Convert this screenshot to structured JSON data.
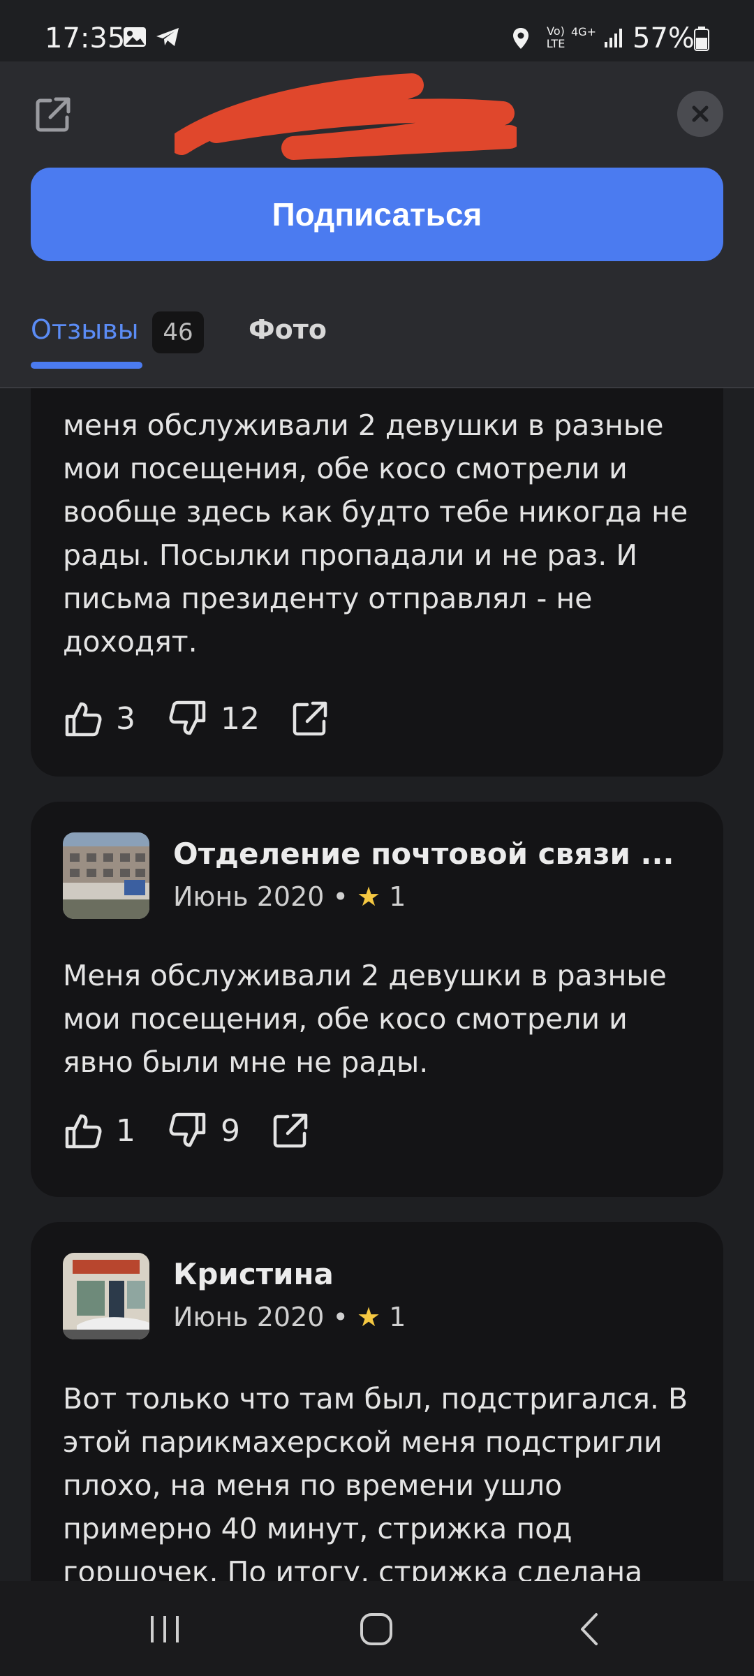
{
  "status_bar": {
    "time": "17:35",
    "battery": "57%",
    "net_lte": "Vo) LTE",
    "net_4g": "4G+"
  },
  "header": {
    "subscribe_label": "Подписаться",
    "tabs": [
      {
        "label": "Отзывы",
        "count": "46"
      },
      {
        "label": "Фото"
      }
    ],
    "accent_color": "#4b7bf0"
  },
  "reviews": [
    {
      "text": "меня обслуживали 2 девушки в разные мои посещения, обе косо смотрели и вообще здесь как будто тебе никогда не рады. Посылки пропадали и не раз. И письма президенту отправлял - не доходят.",
      "likes": "3",
      "dislikes": "12"
    },
    {
      "author": "Отделение почтовой связи ...",
      "date": "Июнь 2020",
      "rating": "1",
      "text": "Меня обслуживали 2 девушки в разные мои посещения, обе косо смотрели и явно были мне не рады.",
      "likes": "1",
      "dislikes": "9"
    },
    {
      "author": "Кристина",
      "date": "Июнь 2020",
      "rating": "1",
      "text": "Вот только что там был, подстригался. В этой парикмахерской меня подстригли плохо, на меня по времени ушло примерно 40 минут, стрижка под горшочек. По итогу, стрижка сделана"
    }
  ]
}
